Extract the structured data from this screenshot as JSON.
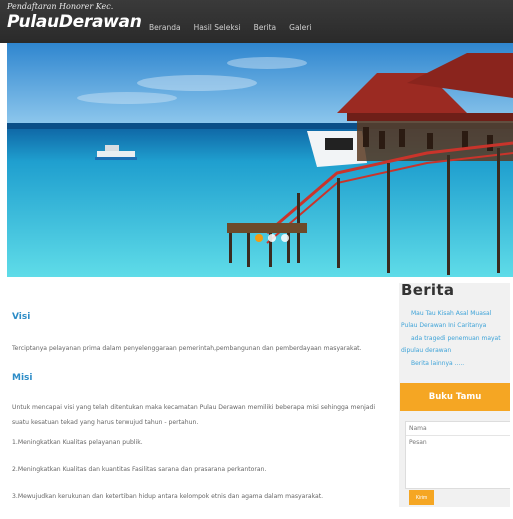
{
  "header": {
    "subtitle": "Pendaftaran Honorer Kec.",
    "site_name": "PulauDerawan",
    "nav": [
      "Beranda",
      "Hasil Seleksi",
      "Berita",
      "Galeri"
    ]
  },
  "hero": {
    "slides": 3,
    "active_slide": 1,
    "colors": {
      "sky": "#4fa7e0",
      "sea": "#1fb6d6",
      "structure": "#b52a2a"
    }
  },
  "content": {
    "visi_heading": "Visi",
    "visi_text": "Terciptanya pelayanan prima dalam penyelenggaraan pemerintah,pembangunan dan pemberdayaan masyarakat.",
    "misi_heading": "Misi",
    "misi_intro": "Untuk mencapai visi yang telah ditentukan maka kecamatan Pulau Derawan memiliki beberapa misi sehingga menjadi suatu kesatuan tekad yang harus terwujud tahun - pertahun.",
    "misi_items": [
      "1.Meningkatkan Kualitas pelayanan publik.",
      "2.Meningkatkan Kualitas dan kuantitas Fasilitas sarana dan prasarana perkantoran.",
      "3.Mewujudkan kerukunan dan ketertiban hidup antara kelompok etnis dan agama dalam masyarakat."
    ]
  },
  "sidebar": {
    "berita_title": "Berita",
    "links": [
      "Mau Tau Kisah Asal Muasal Pulau Derawan Ini Caritanya",
      "ada tragedi penemuan mayat dipulau derawan",
      "Berita lainnya ....."
    ],
    "bukutamu_title": "Buku Tamu",
    "form": {
      "nama_placeholder": "Nama",
      "pesan_placeholder": "Pesan",
      "submit_label": "Kirim"
    }
  },
  "colors": {
    "accent": "#f5a623",
    "link": "#3ea3d8",
    "heading": "#2c8cc7",
    "header_bg": "#333333"
  }
}
